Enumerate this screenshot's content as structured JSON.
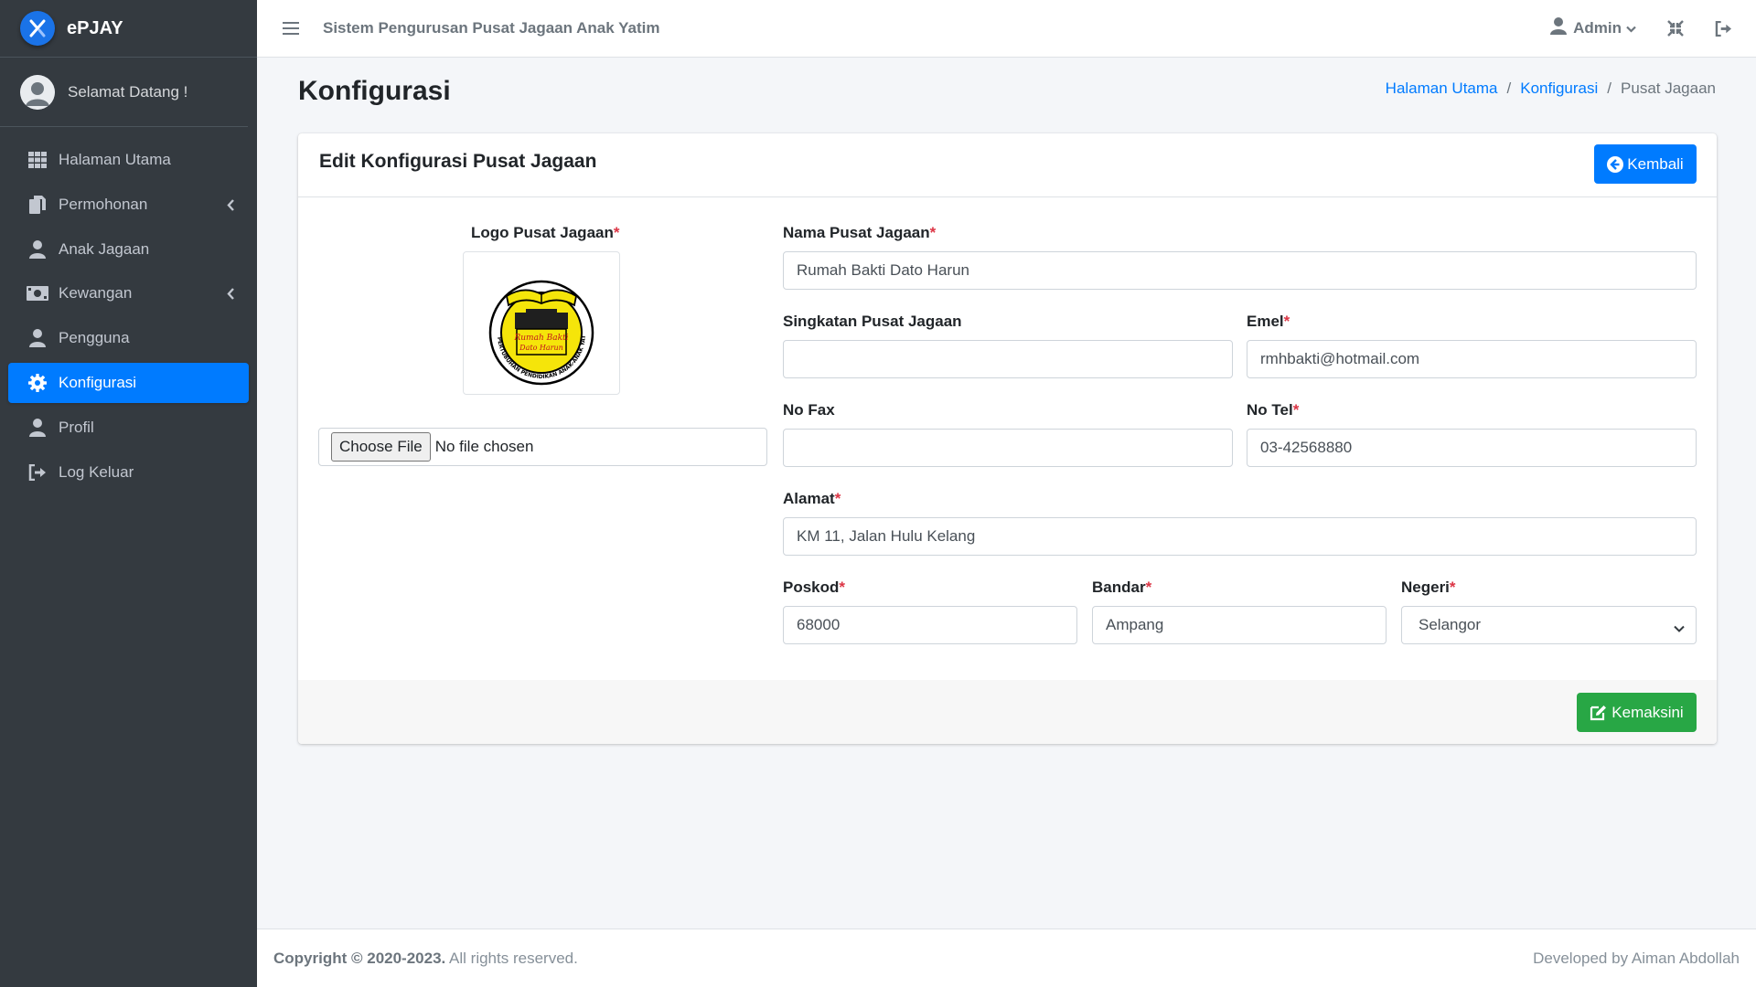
{
  "brand": {
    "name": "ePJAY"
  },
  "user_panel": {
    "welcome": "Selamat Datang !"
  },
  "sidebar": {
    "items": [
      {
        "label": "Halaman Utama",
        "icon": "grid-icon"
      },
      {
        "label": "Permohonan",
        "icon": "copy-icon",
        "has_submenu": true
      },
      {
        "label": "Anak Jagaan",
        "icon": "user-icon"
      },
      {
        "label": "Kewangan",
        "icon": "money-icon",
        "has_submenu": true
      },
      {
        "label": "Pengguna",
        "icon": "user-icon"
      },
      {
        "label": "Konfigurasi",
        "icon": "gear-icon",
        "active": true
      },
      {
        "label": "Profil",
        "icon": "user-icon"
      },
      {
        "label": "Log Keluar",
        "icon": "sign-out-icon"
      }
    ]
  },
  "topbar": {
    "system_title": "Sistem Pengurusan Pusat Jagaan Anak Yatim",
    "user_label": "Admin"
  },
  "page": {
    "title": "Konfigurasi",
    "breadcrumb": {
      "home": "Halaman Utama",
      "section": "Konfigurasi",
      "current": "Pusat Jagaan",
      "separator": "/"
    }
  },
  "card": {
    "title": "Edit Konfigurasi Pusat Jagaan",
    "back_button": "Kembali",
    "update_button": "Kemaksini"
  },
  "form": {
    "logo_label": "Logo Pusat Jagaan",
    "file_button": "Choose File",
    "file_status": "No file chosen",
    "nama_label": "Nama Pusat Jagaan",
    "nama_value": "Rumah Bakti Dato Harun",
    "singkatan_label": "Singkatan Pusat Jagaan",
    "singkatan_value": "",
    "emel_label": "Emel",
    "emel_value": "rmhbakti@hotmail.com",
    "fax_label": "No Fax",
    "fax_value": "",
    "tel_label": "No Tel",
    "tel_value": "03-42568880",
    "alamat_label": "Alamat",
    "alamat_value": "KM 11, Jalan Hulu Kelang",
    "poskod_label": "Poskod",
    "poskod_value": "68000",
    "bandar_label": "Bandar",
    "bandar_value": "Ampang",
    "negeri_label": "Negeri",
    "negeri_value": "Selangor",
    "required_mark": "*"
  },
  "logo_text": {
    "line1": "Rumah Bakti",
    "line2": "Dato Harun",
    "ring": "PERTUBUHAN PENDIDIKAN ANAK-ANAK YATIM SELANGOR"
  },
  "footer": {
    "copyright": "Copyright © 2020-2023.",
    "rights": " All rights reserved.",
    "developer": "Developed by Aiman Abdollah"
  },
  "colors": {
    "sidebar_bg": "#343a40",
    "primary": "#007bff",
    "success": "#28a745",
    "required": "#dc3545"
  }
}
